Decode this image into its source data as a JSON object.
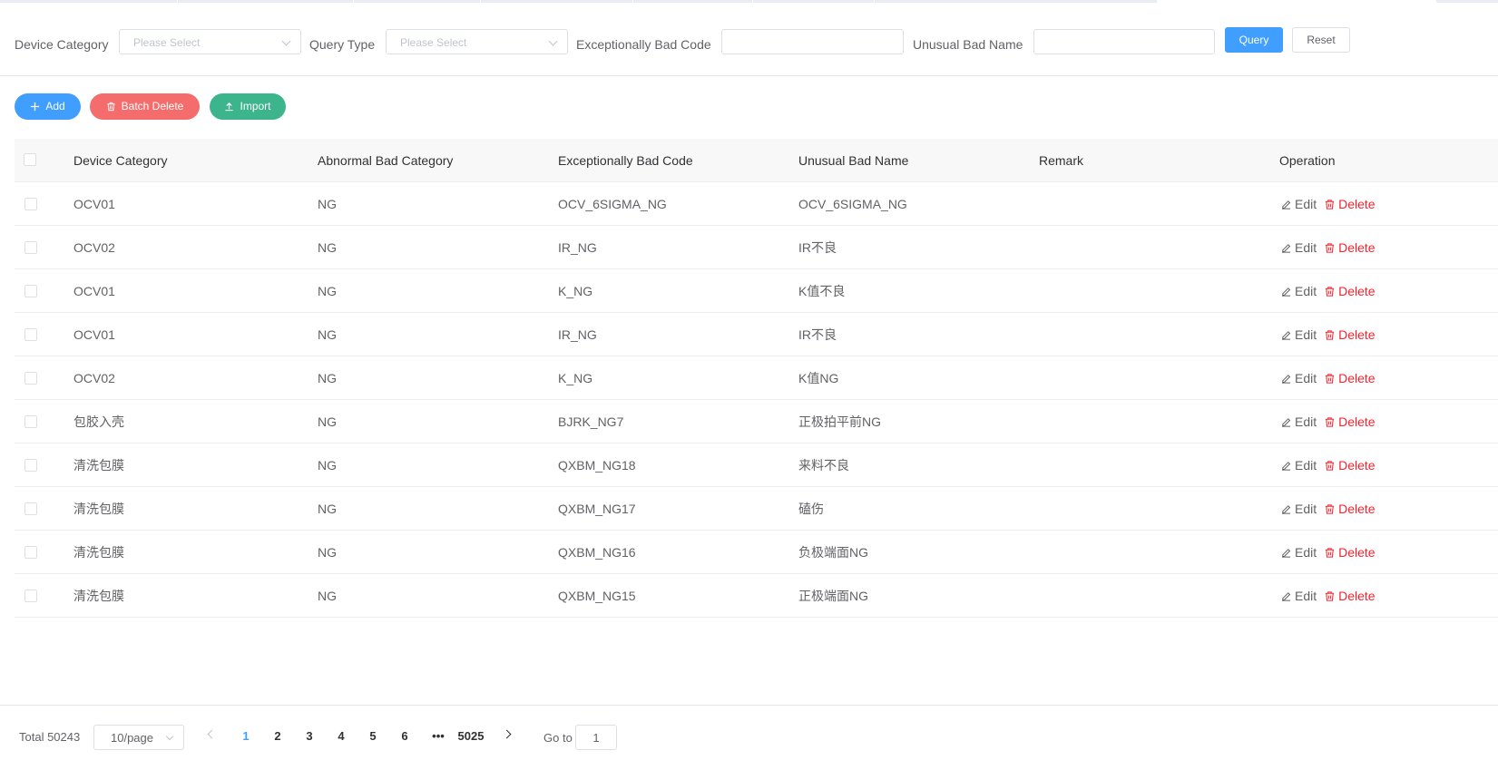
{
  "search": {
    "device_category_label": "Device Category",
    "device_category_placeholder": "Please Select",
    "query_type_label": "Query Type",
    "query_type_placeholder": "Please Select",
    "bad_code_label": "Exceptionally Bad Code",
    "bad_code_value": "",
    "bad_name_label": "Unusual Bad Name",
    "bad_name_value": "",
    "query_button": "Query",
    "reset_button": "Reset"
  },
  "toolbar": {
    "add_label": "Add",
    "batch_delete_label": "Batch Delete",
    "import_label": "Import"
  },
  "table": {
    "columns": [
      "Device Category",
      "Abnormal Bad Category",
      "Exceptionally Bad Code",
      "Unusual Bad Name",
      "Remark",
      "Operation"
    ],
    "edit_label": "Edit",
    "delete_label": "Delete",
    "rows": [
      {
        "device": "OCV01",
        "category": "NG",
        "code": "OCV_6SIGMA_NG",
        "name": "OCV_6SIGMA_NG",
        "remark": ""
      },
      {
        "device": "OCV02",
        "category": "NG",
        "code": "IR_NG",
        "name": "IR不良",
        "remark": ""
      },
      {
        "device": "OCV01",
        "category": "NG",
        "code": "K_NG",
        "name": "K值不良",
        "remark": ""
      },
      {
        "device": "OCV01",
        "category": "NG",
        "code": "IR_NG",
        "name": "IR不良",
        "remark": ""
      },
      {
        "device": "OCV02",
        "category": "NG",
        "code": "K_NG",
        "name": "K值NG",
        "remark": ""
      },
      {
        "device": "包胶入壳",
        "category": "NG",
        "code": "BJRK_NG7",
        "name": "正极拍平前NG",
        "remark": ""
      },
      {
        "device": "清洗包膜",
        "category": "NG",
        "code": "QXBM_NG18",
        "name": "来料不良",
        "remark": ""
      },
      {
        "device": "清洗包膜",
        "category": "NG",
        "code": "QXBM_NG17",
        "name": "磕伤",
        "remark": ""
      },
      {
        "device": "清洗包膜",
        "category": "NG",
        "code": "QXBM_NG16",
        "name": "负极端面NG",
        "remark": ""
      },
      {
        "device": "清洗包膜",
        "category": "NG",
        "code": "QXBM_NG15",
        "name": "正极端面NG",
        "remark": ""
      }
    ]
  },
  "pagination": {
    "total": "Total 50243",
    "page_size": "10/page",
    "pages": [
      "1",
      "2",
      "3",
      "4",
      "5",
      "6"
    ],
    "dots": "•••",
    "last_page": "5025",
    "current_page": "1",
    "goto_label": "Go to",
    "goto_value": "1"
  },
  "colors": {
    "primary": "#409eff",
    "danger": "#f56c6c",
    "success": "#3cb48c",
    "delete_text": "#f5222d"
  }
}
